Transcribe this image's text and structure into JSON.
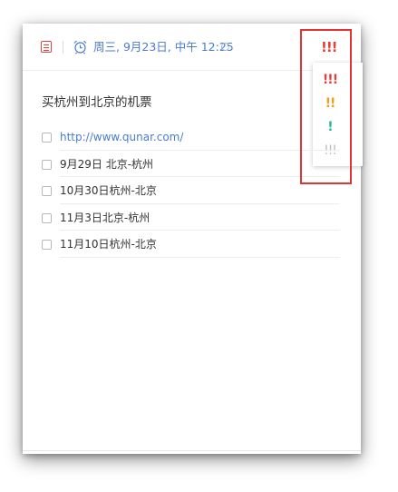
{
  "toolbar": {
    "list_icon": "list-icon",
    "alarm_icon": "alarm-clock-icon",
    "due_text": "周三, 9月23日, 中午 12:25",
    "repeat_icon": "repeat-icon",
    "priority_current": "!!!"
  },
  "priority_menu": {
    "options": [
      {
        "label": "!!!",
        "color": "#e2403a"
      },
      {
        "label": "!!",
        "color": "#f0a020"
      },
      {
        "label": "!",
        "color": "#2bb3a0"
      },
      {
        "label": "!!!",
        "color": "#bdbdbd"
      }
    ]
  },
  "task": {
    "title": "买杭州到北京的机票",
    "checklist": [
      {
        "text": "http://www.qunar.com/",
        "is_link": true,
        "checked": false
      },
      {
        "text": "9月29日 北京-杭州",
        "is_link": false,
        "checked": false
      },
      {
        "text": "10月30日杭州-北京",
        "is_link": false,
        "checked": false
      },
      {
        "text": "11月3日北京-杭州",
        "is_link": false,
        "checked": false
      },
      {
        "text": "11月10日杭州-北京",
        "is_link": false,
        "checked": false
      }
    ]
  },
  "colors": {
    "accent_red": "#e2403a",
    "link_blue": "#4a7bd0",
    "highlight_red": "#e23434"
  }
}
